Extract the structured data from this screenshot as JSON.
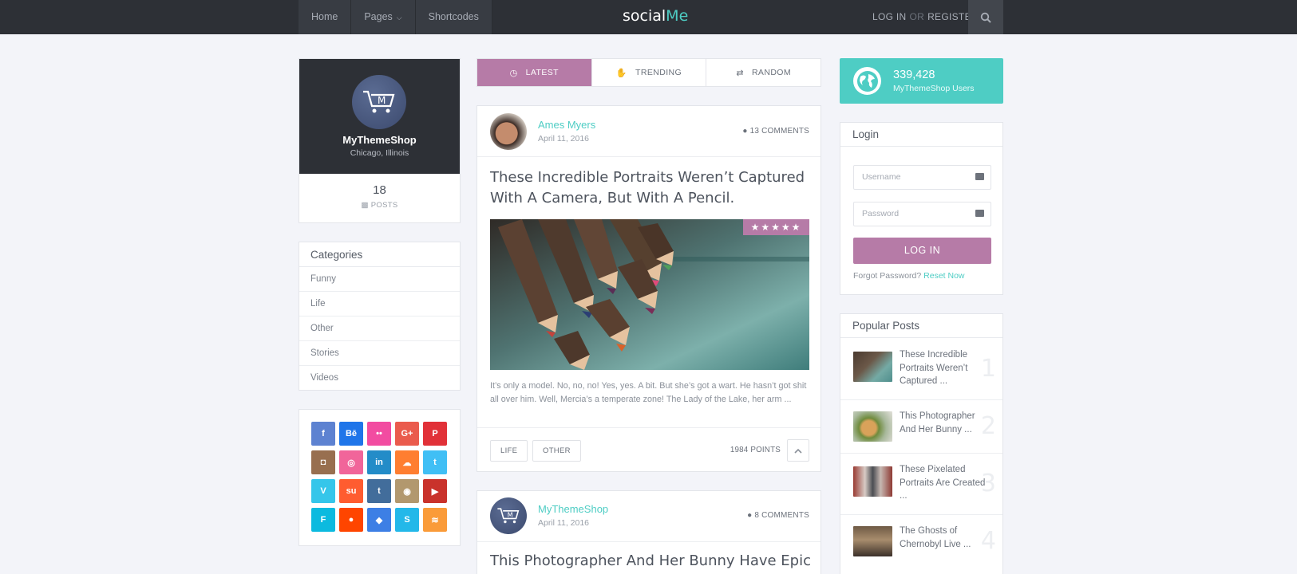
{
  "header": {
    "nav": [
      {
        "label": "Home"
      },
      {
        "label": "Pages"
      },
      {
        "label": "Shortcodes"
      }
    ],
    "logo_main": "social",
    "logo_accent": "Me",
    "login_label": "LOG IN",
    "or_label": "OR",
    "register_label": "REGISTER"
  },
  "profile": {
    "name": "MyThemeShop",
    "location": "Chicago, Illinois",
    "posts_count": "18",
    "posts_label": "POSTS"
  },
  "categories": {
    "title": "Categories",
    "items": [
      "Funny",
      "Life",
      "Other",
      "Stories",
      "Videos"
    ]
  },
  "social": {
    "icons": [
      {
        "name": "facebook-icon",
        "glyph": "f",
        "color": "#5d82d1"
      },
      {
        "name": "behance-icon",
        "glyph": "Bē",
        "color": "#1f75e9"
      },
      {
        "name": "flickr-icon",
        "glyph": "••",
        "color": "#f24ca1"
      },
      {
        "name": "google-plus-icon",
        "glyph": "G+",
        "color": "#ea5b4d"
      },
      {
        "name": "pinterest-icon",
        "glyph": "P",
        "color": "#e13138"
      },
      {
        "name": "instagram-icon",
        "glyph": "◘",
        "color": "#986f4f"
      },
      {
        "name": "dribbble-icon",
        "glyph": "◎",
        "color": "#f1659a"
      },
      {
        "name": "linkedin-icon",
        "glyph": "in",
        "color": "#238cc8"
      },
      {
        "name": "soundcloud-icon",
        "glyph": "☁",
        "color": "#ff7e30"
      },
      {
        "name": "twitter-icon",
        "glyph": "t",
        "color": "#40bff5"
      },
      {
        "name": "vimeo-icon",
        "glyph": "V",
        "color": "#35c6ea"
      },
      {
        "name": "stumbleupon-icon",
        "glyph": "su",
        "color": "#ff5c30"
      },
      {
        "name": "tumblr-icon",
        "glyph": "t",
        "color": "#426d9b"
      },
      {
        "name": "github-icon",
        "glyph": "◉",
        "color": "#b2986e"
      },
      {
        "name": "youtube-icon",
        "glyph": "▶",
        "color": "#c9322b"
      },
      {
        "name": "foursquare-icon",
        "glyph": "F",
        "color": "#0cbadf"
      },
      {
        "name": "reddit-icon",
        "glyph": "●",
        "color": "#ff4500"
      },
      {
        "name": "dropbox-icon",
        "glyph": "◆",
        "color": "#3d7fe5"
      },
      {
        "name": "skype-icon",
        "glyph": "S",
        "color": "#23b8e9"
      },
      {
        "name": "rss-icon",
        "glyph": "≋",
        "color": "#fa9b39"
      }
    ]
  },
  "tabs": [
    {
      "label": "LATEST",
      "icon": "clock-icon",
      "active": true
    },
    {
      "label": "TRENDING",
      "icon": "thumbs-up-icon",
      "active": false
    },
    {
      "label": "RANDOM",
      "icon": "shuffle-icon",
      "active": false
    }
  ],
  "post1": {
    "author": "Ames Myers",
    "date": "April 11, 2016",
    "comments": "13 COMMENTS",
    "title": "These Incredible Portraits Weren’t Captured With A Camera, But With A Pencil.",
    "rating_stars": 5,
    "excerpt": "It’s only a model. No, no, no! Yes, yes. A bit. But she’s got a wart. He hasn’t got shit all over him. Well, Mercia’s a temperate zone! The Lady of the Lake, her arm ...",
    "tags": [
      "LIFE",
      "OTHER"
    ],
    "points": "1984 POINTS"
  },
  "post2": {
    "author": "MyThemeShop",
    "date": "April 11, 2016",
    "comments": "8 COMMENTS",
    "title": "This Photographer And Her Bunny Have Epic"
  },
  "users": {
    "count": "339,428",
    "label": "MyThemeShop Users"
  },
  "login": {
    "title": "Login",
    "username_placeholder": "Username",
    "password_placeholder": "Password",
    "button": "LOG IN",
    "forgot": "Forgot Password?",
    "reset": "Reset Now"
  },
  "popular": {
    "title": "Popular Posts",
    "items": [
      {
        "title": "These Incredible Portraits Weren’t Captured ...",
        "num": "1"
      },
      {
        "title": "This Photographer And Her Bunny ...",
        "num": "2"
      },
      {
        "title": "These Pixelated Portraits Are Created ...",
        "num": "3"
      },
      {
        "title": "The Ghosts of Chernobyl Live ...",
        "num": "4"
      }
    ]
  }
}
